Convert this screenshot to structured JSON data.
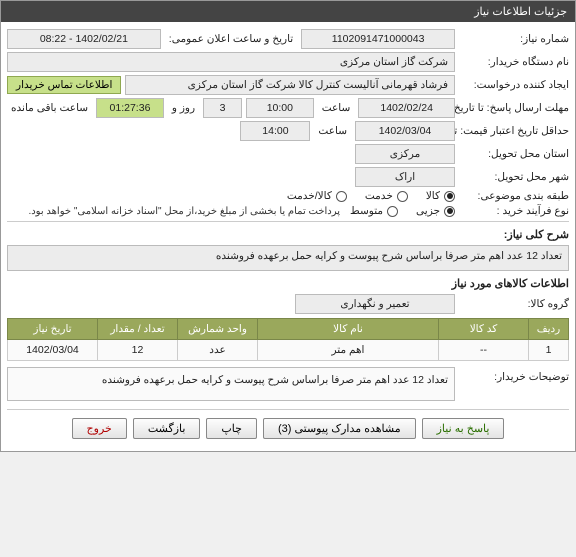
{
  "window": {
    "title": "جزئیات اطلاعات نیاز"
  },
  "fields": {
    "need_no_label": "شماره نیاز:",
    "need_no": "1102091471000043",
    "announce_label": "تاریخ و ساعت اعلان عمومی:",
    "announce_value": "1402/02/21 - 08:22",
    "buyer_org_label": "نام دستگاه خریدار:",
    "buyer_org": "شرکت گاز استان مرکزی",
    "requester_label": "ایجاد کننده درخواست:",
    "requester": "فرشاد قهرمانی آنالیست کنترل کالا شرکت گاز استان مرکزی",
    "contact_btn": "اطلاعات تماس خریدار",
    "deadline_label": "مهلت ارسال پاسخ: تا تاریخ:",
    "deadline_date": "1402/02/24",
    "time_lbl": "ساعت",
    "deadline_time": "10:00",
    "day_lbl": "روز و",
    "days_left": "3",
    "time_left": "01:27:36",
    "remain_lbl": "ساعت باقی مانده",
    "validity_label": "حداقل تاریخ اعتبار قیمت: تا تاریخ:",
    "validity_date": "1402/03/04",
    "validity_time": "14:00",
    "province_label": "استان محل تحویل:",
    "province": "مرکزی",
    "city_label": "شهر محل تحویل:",
    "city": "اراک",
    "category_label": "طبقه بندی موضوعی:",
    "cat_goods": "کالا",
    "cat_service": "خدمت",
    "cat_both": "کالا/خدمت",
    "purchase_type_label": "نوع فرآیند خرید :",
    "pt_partial": "جزیی",
    "pt_medium": "متوسط",
    "pt_note": "پرداخت تمام یا بخشی از مبلغ خرید،از محل \"اسناد خزانه اسلامی\" خواهد بود.",
    "summary_label": "شرح کلی نیاز:",
    "summary": "تعداد 12 عدد اهم متر صرفا براساس شرح پیوست و کرایه حمل برعهده فروشنده",
    "items_section": "اطلاعات کالاهای مورد نیاز",
    "goods_group_label": "گروه کالا:",
    "goods_group": "تعمیر و نگهداری",
    "buyer_notes_label": "توضیحات خریدار:",
    "buyer_notes": "تعداد 12 عدد اهم متر صرفا براساس شرح پیوست و کرایه حمل برعهده فروشنده"
  },
  "table": {
    "headers": {
      "row": "ردیف",
      "code": "کد کالا",
      "name": "نام کالا",
      "unit": "واحد شمارش",
      "qty": "تعداد / مقدار",
      "date": "تاریخ نیاز"
    },
    "rows": [
      {
        "row": "1",
        "code": "--",
        "name": "اهم متر",
        "unit": "عدد",
        "qty": "12",
        "date": "1402/03/04"
      }
    ]
  },
  "footer": {
    "respond": "پاسخ به نیاز",
    "attachments": "مشاهده مدارک پیوستی (3)",
    "print": "چاپ",
    "back": "بازگشت",
    "exit": "خروج"
  }
}
